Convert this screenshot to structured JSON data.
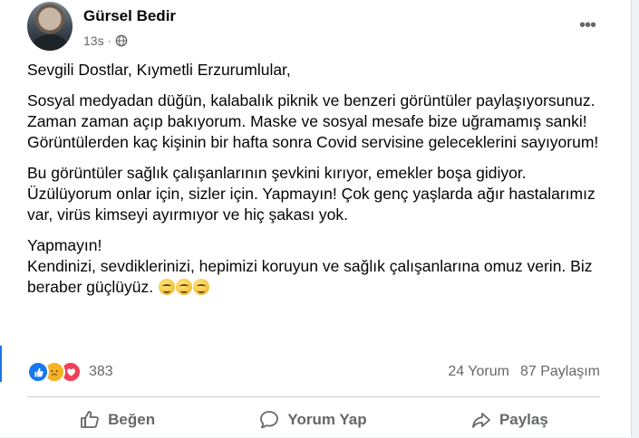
{
  "post": {
    "author": "Gürsel Bedir",
    "time": "13s",
    "separator": "·",
    "more_icon": "more-horizontal-icon",
    "audience_icon": "globe-icon",
    "paragraphs": [
      "Sevgili Dostlar, Kıymetli Erzurumlular,",
      "Sosyal medyadan düğün, kalabalık piknik ve benzeri görüntüler paylaşıyorsunuz. Zaman zaman açıp bakıyorum. Maske ve sosyal mesafe bize uğramamış sanki! Görüntülerden kaç kişinin bir hafta sonra Covid servisine geleceklerini sayıyorum!",
      "Bu görüntüler sağlık çalışanlarının şevkini kırıyor, emekler boşa gidiyor. Üzülüyorum onlar için, sizler için. Yapmayın! Çok genç yaşlarda ağır hastalarımız var, virüs kimseyi ayırmıyor ve hiç şakası yok."
    ],
    "closing_line1": "Yapmayın!",
    "closing_line2": "Kendinizi, sevdiklerinizi, hepimizi koruyun ve sağlık çalışanlarına omuz verin. Biz beraber güçlüyüz."
  },
  "stats": {
    "reaction_count": "383",
    "comments": "24 Yorum",
    "shares": "87 Paylaşım"
  },
  "actions": {
    "like": "Beğen",
    "comment": "Yorum Yap",
    "share": "Paylaş"
  },
  "colors": {
    "like_blue": "#1877f2",
    "love_red": "#f33e58",
    "sad_yellow": "#f7b125",
    "secondary_text": "#65676b"
  }
}
